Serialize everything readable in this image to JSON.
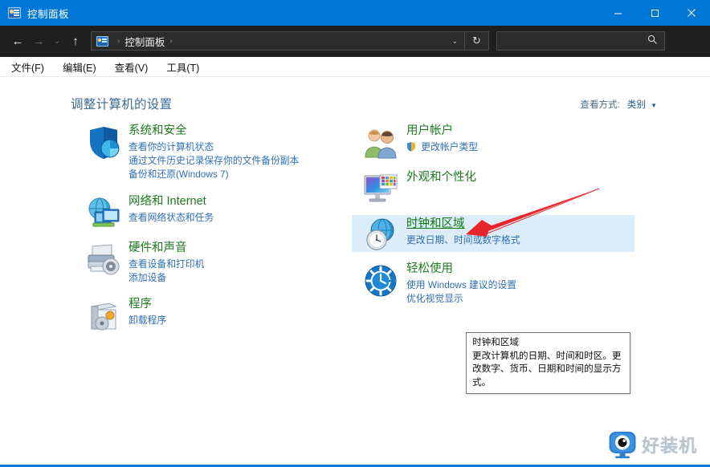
{
  "window": {
    "title": "控制面板",
    "icon": "control-panel-icon",
    "buttons": {
      "minimize": "minimize-icon",
      "maximize": "maximize-icon",
      "close": "close-icon"
    }
  },
  "nav": {
    "back": "back-arrow-icon",
    "forward": "forward-arrow-icon",
    "recent": "chevron-down-icon",
    "up": "up-arrow-icon",
    "breadcrumb": {
      "root_icon": "control-panel-icon",
      "items": [
        "控制面板"
      ],
      "separator": "›"
    },
    "address_caret": "chevron-down-icon",
    "refresh": "refresh-icon",
    "search": {
      "placeholder": "",
      "value": "",
      "icon": "search-icon"
    }
  },
  "menubar": {
    "items": [
      "文件(F)",
      "编辑(E)",
      "查看(V)",
      "工具(T)"
    ]
  },
  "main": {
    "heading": "调整计算机的设置",
    "view_by": {
      "label": "查看方式:",
      "value": "类别",
      "caret": "▼"
    },
    "left_column": [
      {
        "icon": "shield-security-icon",
        "title": "系统和安全",
        "links": [
          {
            "text": "查看你的计算机状态",
            "uac": false
          },
          {
            "text": "通过文件历史记录保存你的文件备份副本",
            "uac": false
          },
          {
            "text": "备份和还原(Windows 7)",
            "uac": false
          }
        ]
      },
      {
        "icon": "network-globe-icon",
        "title": "网络和 Internet",
        "links": [
          {
            "text": "查看网络状态和任务",
            "uac": false
          }
        ]
      },
      {
        "icon": "printer-hardware-icon",
        "title": "硬件和声音",
        "links": [
          {
            "text": "查看设备和打印机",
            "uac": false
          },
          {
            "text": "添加设备",
            "uac": false
          }
        ]
      },
      {
        "icon": "programs-box-icon",
        "title": "程序",
        "links": [
          {
            "text": "卸载程序",
            "uac": false
          }
        ]
      }
    ],
    "right_column": [
      {
        "icon": "user-accounts-icon",
        "title": "用户帐户",
        "links": [
          {
            "text": "更改帐户类型",
            "uac": true
          }
        ]
      },
      {
        "icon": "appearance-monitor-icon",
        "title": "外观和个性化",
        "links": []
      },
      {
        "icon": "clock-region-icon",
        "title": "时钟和区域",
        "highlighted": true,
        "links": [
          {
            "text": "更改日期、时间或数字格式",
            "uac": false
          }
        ]
      },
      {
        "icon": "ease-of-access-icon",
        "title": "轻松使用",
        "links": [
          {
            "text": "使用 Windows 建议的设置",
            "uac": false
          },
          {
            "text": "优化视觉显示",
            "uac": false
          }
        ]
      }
    ]
  },
  "tooltip": {
    "title": "时钟和区域",
    "body": "更改计算机的日期、时间和时区。更改数字、货币、日期和时间的显示方式。"
  },
  "annotation": {
    "arrow": "red-arrow-pointer",
    "color": "#e8262a"
  },
  "watermark": {
    "text": "好装机",
    "logo": "eye-monitor-logo"
  },
  "colors": {
    "titlebar": "#0078d7",
    "navbar": "#1f1f1f",
    "category_title": "#1d7a1d",
    "link": "#2f6fb5",
    "heading": "#3e6b94",
    "highlight_row": "#dcecf9"
  }
}
